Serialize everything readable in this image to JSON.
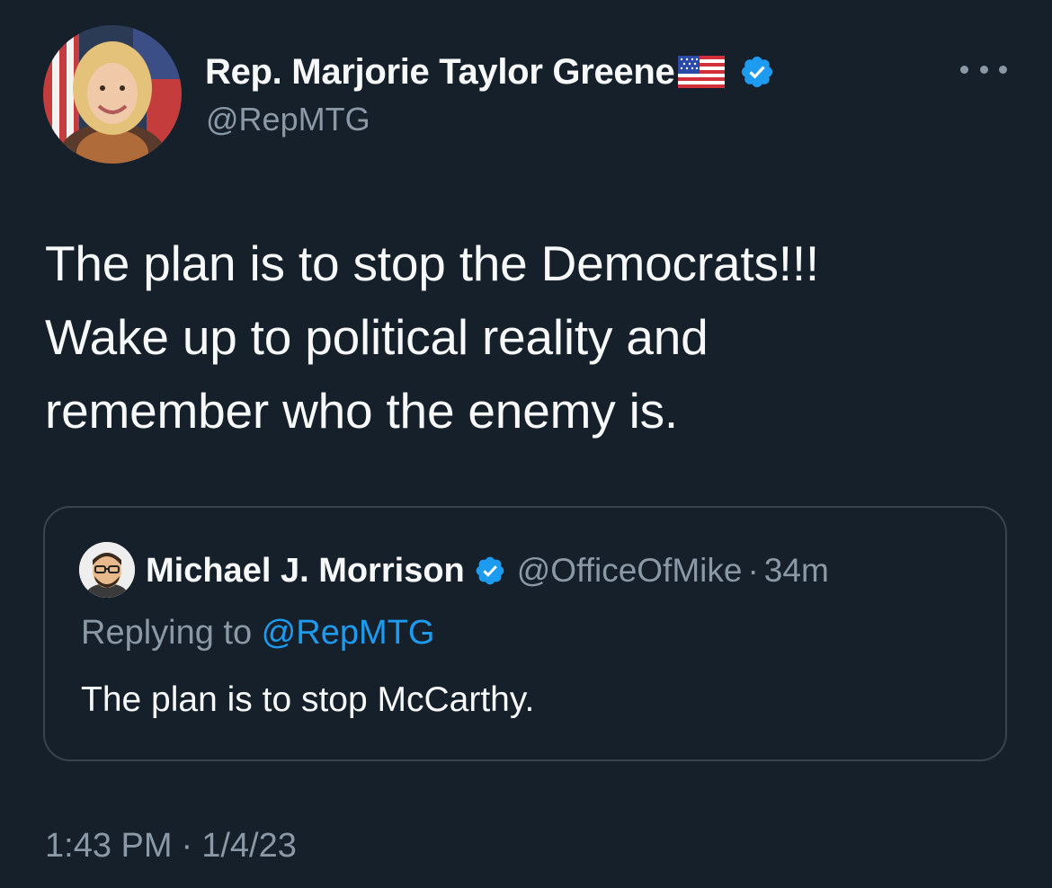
{
  "author": {
    "name": "Rep. Marjorie Taylor Greene",
    "handle": "@RepMTG",
    "verified": true,
    "flag_icon": "us-flag-emoji"
  },
  "tweet": {
    "lines": [
      "The plan is to stop the Democrats!!!",
      "Wake up to political reality and",
      "remember who the enemy is."
    ]
  },
  "quoted": {
    "name": "Michael J. Morrison",
    "verified": true,
    "handle": "@OfficeOfMike",
    "separator": "·",
    "time": "34m",
    "replying_prefix": "Replying to ",
    "replying_to": "@RepMTG",
    "text": "The plan is to stop McCarthy."
  },
  "timestamp": {
    "time": "1:43 PM",
    "separator": "·",
    "date": "1/4/23"
  },
  "colors": {
    "background": "#15202b",
    "text": "#f7f9f9",
    "secondary": "#8b98a5",
    "accent": "#1d9bf0",
    "border": "#38444d"
  }
}
